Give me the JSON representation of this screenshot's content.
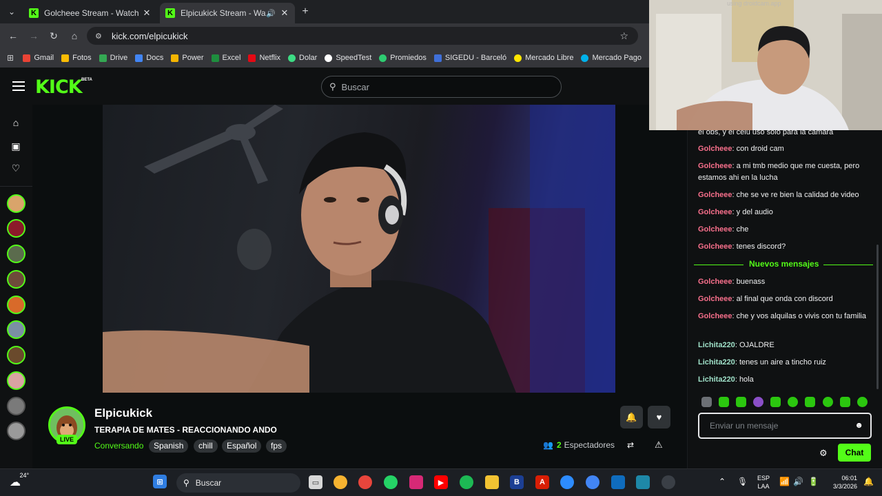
{
  "browser": {
    "tabs": [
      {
        "title": "Golcheee Stream - Watch Live o"
      },
      {
        "title": "Elpicukick Stream - Watch Li"
      }
    ],
    "url": "kick.com/elpicukick",
    "bookmarks": [
      {
        "label": "Gmail",
        "color": "#ea4335"
      },
      {
        "label": "Fotos",
        "color": "#fbbc04"
      },
      {
        "label": "Drive",
        "color": "#34a853"
      },
      {
        "label": "Docs",
        "color": "#4285f4"
      },
      {
        "label": "Power",
        "color": "#f4b400"
      },
      {
        "label": "Excel",
        "color": "#1e8e3e"
      },
      {
        "label": "Netflix",
        "color": "#e50914"
      },
      {
        "label": "Dolar",
        "color": "#3ddc84"
      },
      {
        "label": "SpeedTest",
        "color": "#ffffff"
      },
      {
        "label": "Promiedos",
        "color": "#2ecc71"
      },
      {
        "label": "SIGEDU - Barceló",
        "color": "#3f6fd8"
      },
      {
        "label": "Mercado Libre",
        "color": "#ffe600"
      },
      {
        "label": "Mercado Pago",
        "color": "#00b1ea"
      }
    ]
  },
  "kick": {
    "brand_color": "#53fc18",
    "logo": "KICK",
    "beta": "BETA",
    "search_placeholder": "Buscar"
  },
  "stream": {
    "streamer": "Elpicukick",
    "live_label": "LIVE",
    "title": "TERAPIA DE MATES - REACCIONANDO ANDO",
    "category": "Conversando",
    "tags": [
      "Spanish",
      "chill",
      "Español",
      "fps"
    ],
    "viewers_count": "2",
    "viewers_label": "Espectadores"
  },
  "chat": {
    "partial_top": "el obs, y el celu uso solo para la camara",
    "messages_before": [
      {
        "user": "Golcheee",
        "color": "#f76f8b",
        "text": "con droid cam"
      },
      {
        "user": "Golcheee",
        "color": "#f76f8b",
        "text": "a mi tmb medio que me cuesta, pero estamos ahi en la lucha"
      },
      {
        "user": "Golcheee",
        "color": "#f76f8b",
        "text": "che se ve re bien la calidad de video"
      },
      {
        "user": "Golcheee",
        "color": "#f76f8b",
        "text": "y del audio"
      },
      {
        "user": "Golcheee",
        "color": "#f76f8b",
        "text": "che"
      },
      {
        "user": "Golcheee",
        "color": "#f76f8b",
        "text": "tenes discord?"
      }
    ],
    "new_messages_label": "Nuevos mensajes",
    "messages_after": [
      {
        "user": "Golcheee",
        "color": "#f76f8b",
        "text": "buenass"
      },
      {
        "user": "Golcheee",
        "color": "#f76f8b",
        "text": "al final que onda con discord"
      },
      {
        "user": "Golcheee",
        "color": "#f76f8b",
        "text": "che y vos alquilas o vivis con tu familia"
      },
      {
        "user": "Lichita220",
        "color": "#9fe0c8",
        "text": "OJALDRE"
      },
      {
        "user": "Lichita220",
        "color": "#9fe0c8",
        "text": "tenes un aire a tincho ruiz"
      },
      {
        "user": "Lichita220",
        "color": "#9fe0c8",
        "text": "hola"
      }
    ],
    "input_placeholder": "Enviar un mensaje",
    "send_label": "Chat"
  },
  "webcam_watermark": "using droidcam.app",
  "taskbar": {
    "temperature": "24°",
    "search_placeholder": "Buscar",
    "lang_line1": "ESP",
    "lang_line2": "LAA",
    "time": "06:01",
    "date": "3/3/2026"
  }
}
